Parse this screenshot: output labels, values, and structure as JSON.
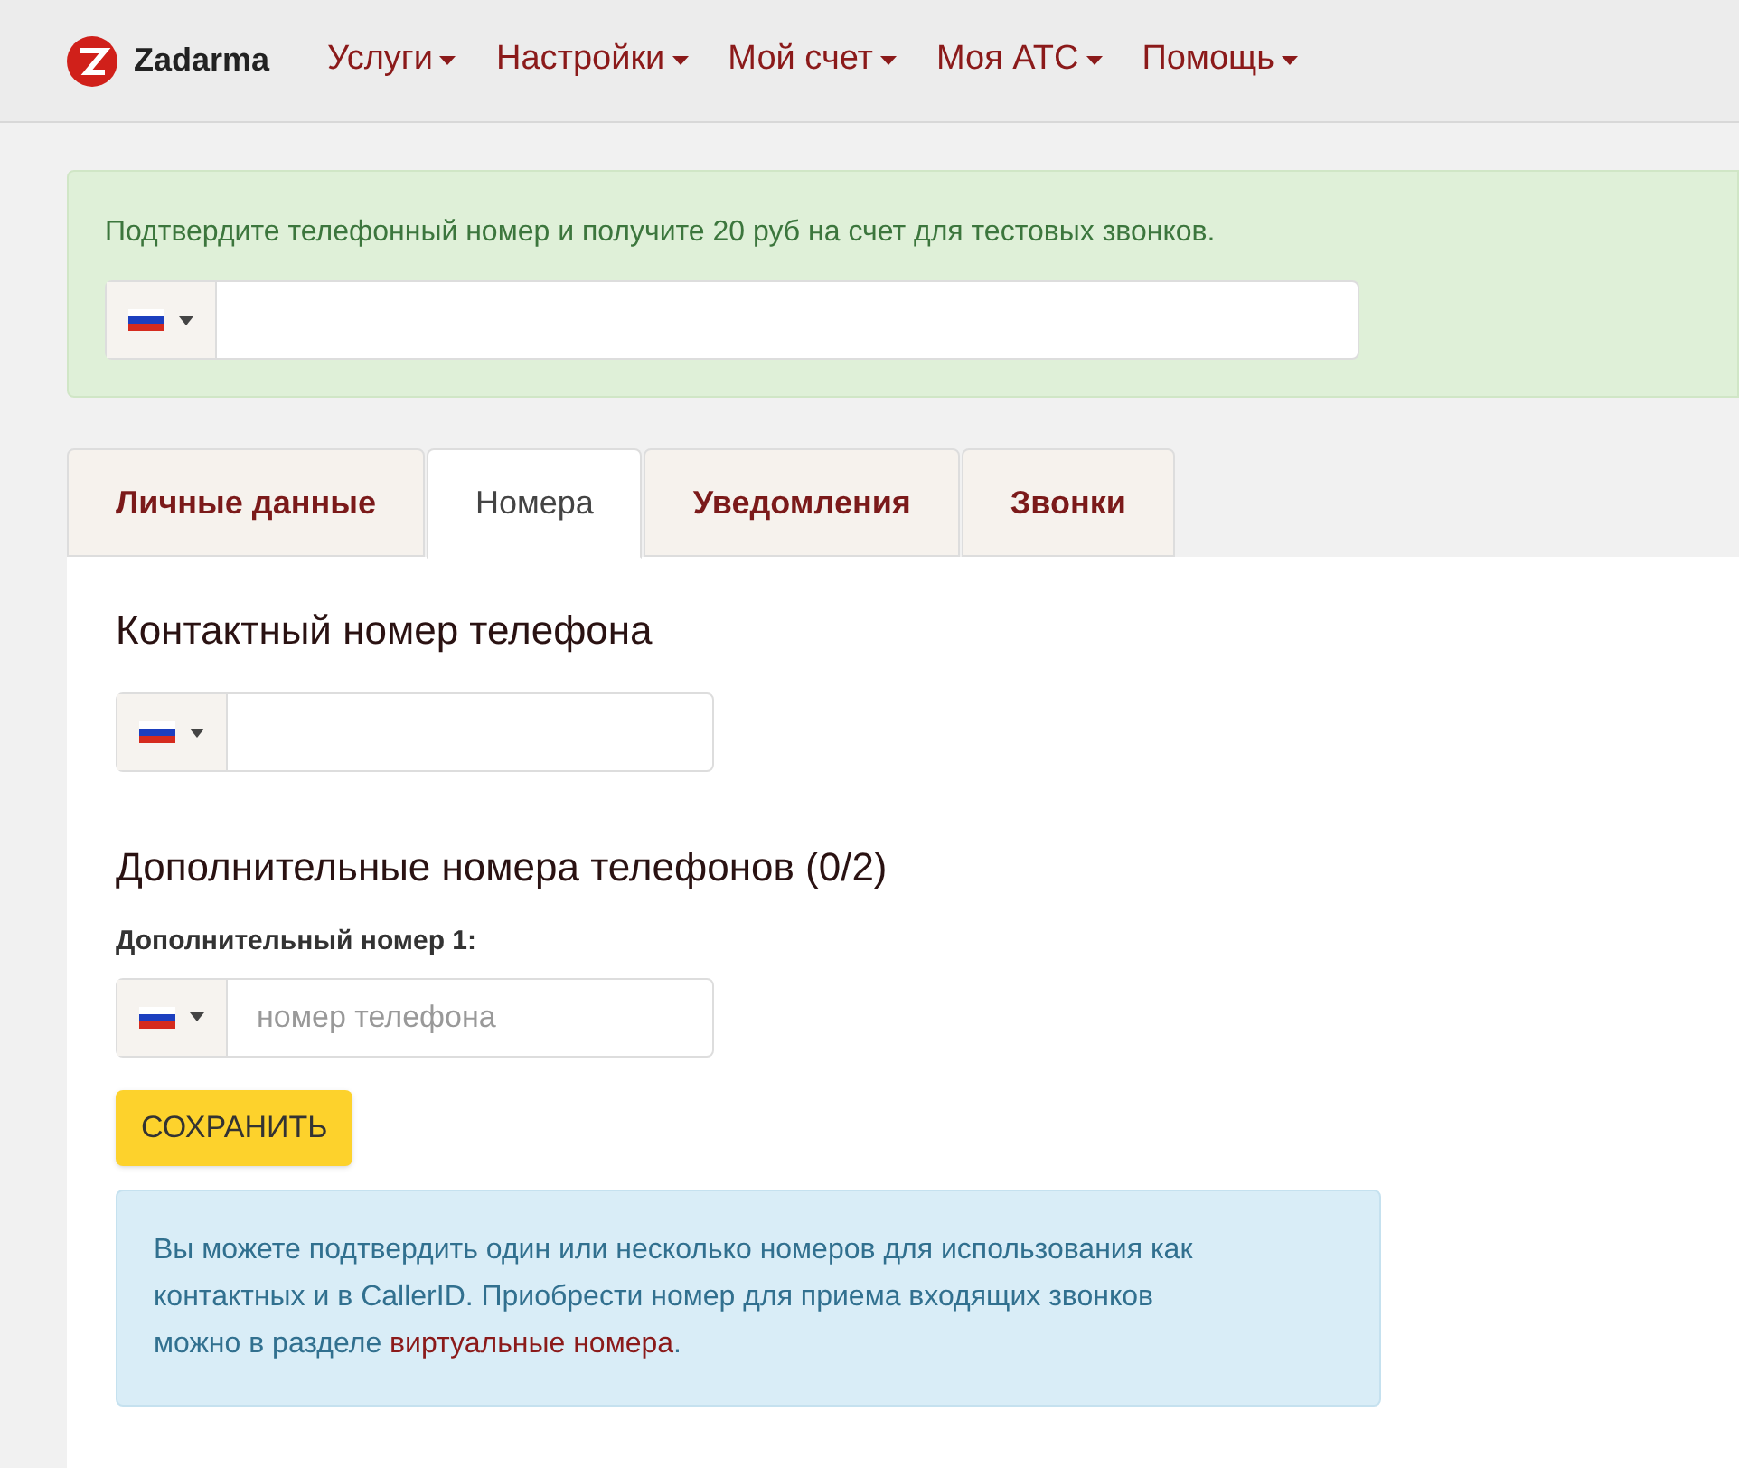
{
  "nav": {
    "brand": "Zadarma",
    "menu": [
      {
        "label": "Услуги"
      },
      {
        "label": "Настройки"
      },
      {
        "label": "Мой счет"
      },
      {
        "label": "Моя АТС"
      },
      {
        "label": "Помощь"
      }
    ]
  },
  "verify_alert": {
    "text": "Подтвердите телефонный номер и получите 20 руб на счет для тестовых звонков."
  },
  "tabs": [
    {
      "label": "Личные данные",
      "selected": false
    },
    {
      "label": "Номера",
      "selected": true
    },
    {
      "label": "Уведомления",
      "selected": false
    },
    {
      "label": "Звонки",
      "selected": false
    }
  ],
  "contact": {
    "heading": "Контактный номер телефона"
  },
  "extra": {
    "heading": "Дополнительные номера телефонов (0/2)",
    "field_label": "Дополнительный номер 1:",
    "placeholder": "номер телефона"
  },
  "save_button": "СОХРАНИТЬ",
  "info": {
    "text_before": "Вы можете подтвердить один или несколько номеров для использования как контактных и в CallerID. Приобрести номер для приема входящих звонков можно в разделе ",
    "link": "виртуальные номера",
    "text_after": "."
  }
}
